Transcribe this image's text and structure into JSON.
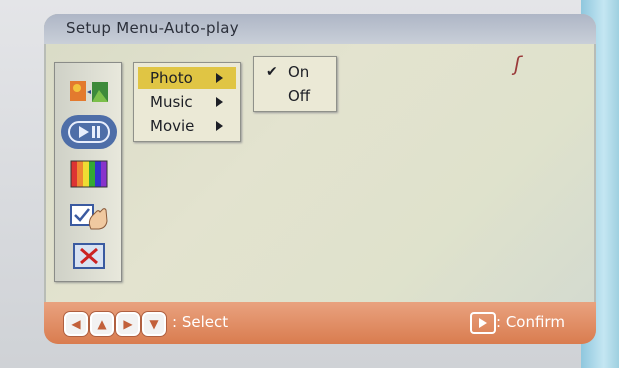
{
  "title": "Setup Menu-Auto-play",
  "sidebar": {
    "items": [
      {
        "icon": "photo-settings-icon"
      },
      {
        "icon": "autoplay-icon",
        "selected": true
      },
      {
        "icon": "display-color-icon"
      },
      {
        "icon": "hand-check-icon"
      },
      {
        "icon": "exit-icon"
      }
    ]
  },
  "menu": {
    "items": [
      {
        "label": "Photo",
        "active": true
      },
      {
        "label": "Music"
      },
      {
        "label": "Movie"
      }
    ]
  },
  "submenu": {
    "options": [
      {
        "label": "On",
        "checked": true
      },
      {
        "label": "Off",
        "checked": false
      }
    ]
  },
  "corner_mark": "ʃ",
  "footer": {
    "select_label": ": Select",
    "confirm_label": ": Confirm"
  },
  "colors": {
    "highlight": "#e0c544",
    "footer": "#d97c4f",
    "selected_icon_bg": "#4e6ea8"
  }
}
